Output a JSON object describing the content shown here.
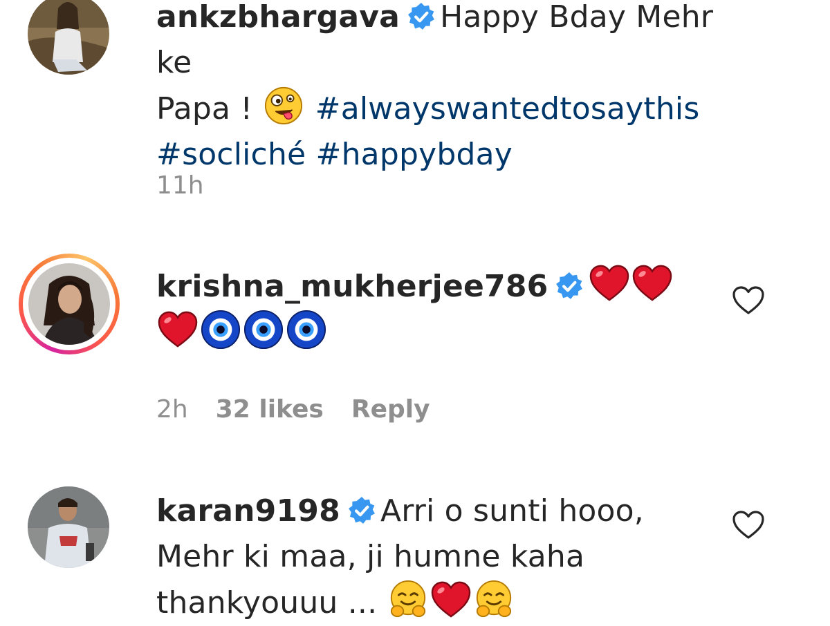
{
  "comments": [
    {
      "username": "ankzbhargava",
      "verified": true,
      "text_1": "Happy Bday Mehr ke",
      "text_2": "Papa ! ",
      "emoji_after_text": "zany-face",
      "hashtags": [
        "#alwayswantedtosaythis",
        "#socliché",
        "#happybday"
      ],
      "time": "11h"
    },
    {
      "username": "krishna_mukherjee786",
      "verified": true,
      "has_story_ring": true,
      "emojis": [
        "red-heart",
        "red-heart",
        "red-heart",
        "nazar-amulet",
        "nazar-amulet",
        "nazar-amulet"
      ],
      "time": "2h",
      "likes": "32 likes",
      "reply": "Reply"
    },
    {
      "username": "karan9198",
      "verified": true,
      "text_1": "Arri o sunti hooo,",
      "text_2": "Mehr ki maa, ji humne kaha",
      "text_3": "thankyouuu ... ",
      "emojis": [
        "smiling-face-with-open-hands",
        "red-heart",
        "smiling-face-with-open-hands"
      ]
    }
  ],
  "colors": {
    "text": "#262626",
    "meta": "#8e8e8e",
    "hashtag": "#00376b",
    "verified": "#3897f0",
    "heart": "#e0152b"
  }
}
